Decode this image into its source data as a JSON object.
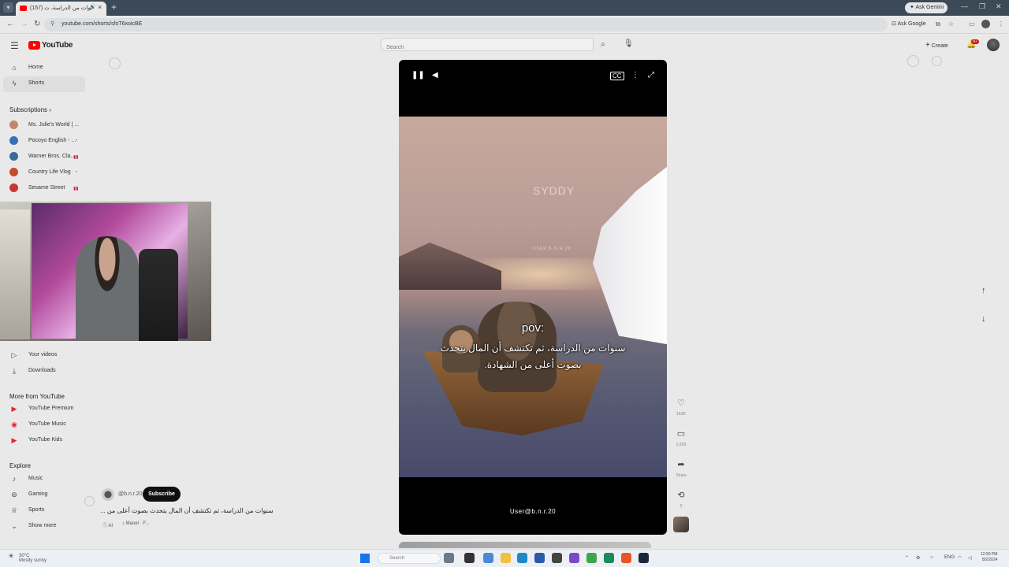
{
  "browser": {
    "tab_title": "(157) سنوات من الدراسة، ث",
    "url": "youtube.com/shorts/sfoT6xoicBE",
    "ask_gemini": "Ask Gemini",
    "ask_google": "Ask Google"
  },
  "header": {
    "logo_text": "YouTube",
    "search_placeholder": "Search",
    "create_label": "Create",
    "notification_badge": "9+"
  },
  "sidebar": {
    "top_items": [
      {
        "label": "Home",
        "icon": "home-icon"
      },
      {
        "label": "Shorts",
        "icon": "shorts-icon"
      }
    ],
    "subscriptions_heading": "Subscriptions",
    "subscriptions": [
      {
        "label": "Ms. Julie's World | ...",
        "color": "#c08a6a"
      },
      {
        "label": "Pocoyo English - ...",
        "color": "#3b6fb8"
      },
      {
        "label": "Warner Bros. Cla...",
        "color": "#3a6a9a"
      },
      {
        "label": "Country Life Vlog",
        "color": "#c84a2a"
      },
      {
        "label": "Sesame Street",
        "color": "#cc3333"
      }
    ],
    "you_items": [
      {
        "label": "Your videos",
        "icon": "your-videos-icon"
      },
      {
        "label": "Downloads",
        "icon": "download-icon"
      }
    ],
    "more_heading": "More from YouTube",
    "more_items": [
      {
        "label": "YouTube Premium",
        "color": "#ff0000"
      },
      {
        "label": "YouTube Music",
        "color": "#ff0000"
      },
      {
        "label": "YouTube Kids",
        "color": "#ff0000"
      }
    ],
    "explore_heading": "Explore",
    "explore_items": [
      {
        "label": "Music",
        "icon": "music-icon"
      },
      {
        "label": "Gaming",
        "icon": "gaming-icon"
      },
      {
        "label": "Sports",
        "icon": "trophy-icon"
      },
      {
        "label": "Show more",
        "icon": "chevron-down-icon"
      }
    ]
  },
  "video": {
    "watermark": "SYDDY",
    "watermark_sub": "USER:B.N.R.20",
    "pov_text": "pov:",
    "caption": "سنوات من الدراسة، ثم تكتشف أن المال يتحدث بصوت أعلى من الشهادة.",
    "user_tag": "User@b.n.r.20",
    "progress": 0.98
  },
  "actions": {
    "likes": "163K",
    "comments": "2,959",
    "share_label": "Share",
    "remix_count": "3"
  },
  "channel": {
    "handle": "@b.n.r.20",
    "subscribe_label": "Subscribe",
    "video_title": "سنوات من الدراسة، ثم تكتشف أن المال يتحدث بصوت أعلى من ...",
    "ai_label": "AI",
    "sound_label": "Maoel · F..."
  },
  "taskbar": {
    "weather_temp": "30°C",
    "weather_desc": "Mostly sunny",
    "search_placeholder": "Search",
    "lang": "ENG",
    "time": "12:50 PM",
    "date": "8/2/2024"
  }
}
